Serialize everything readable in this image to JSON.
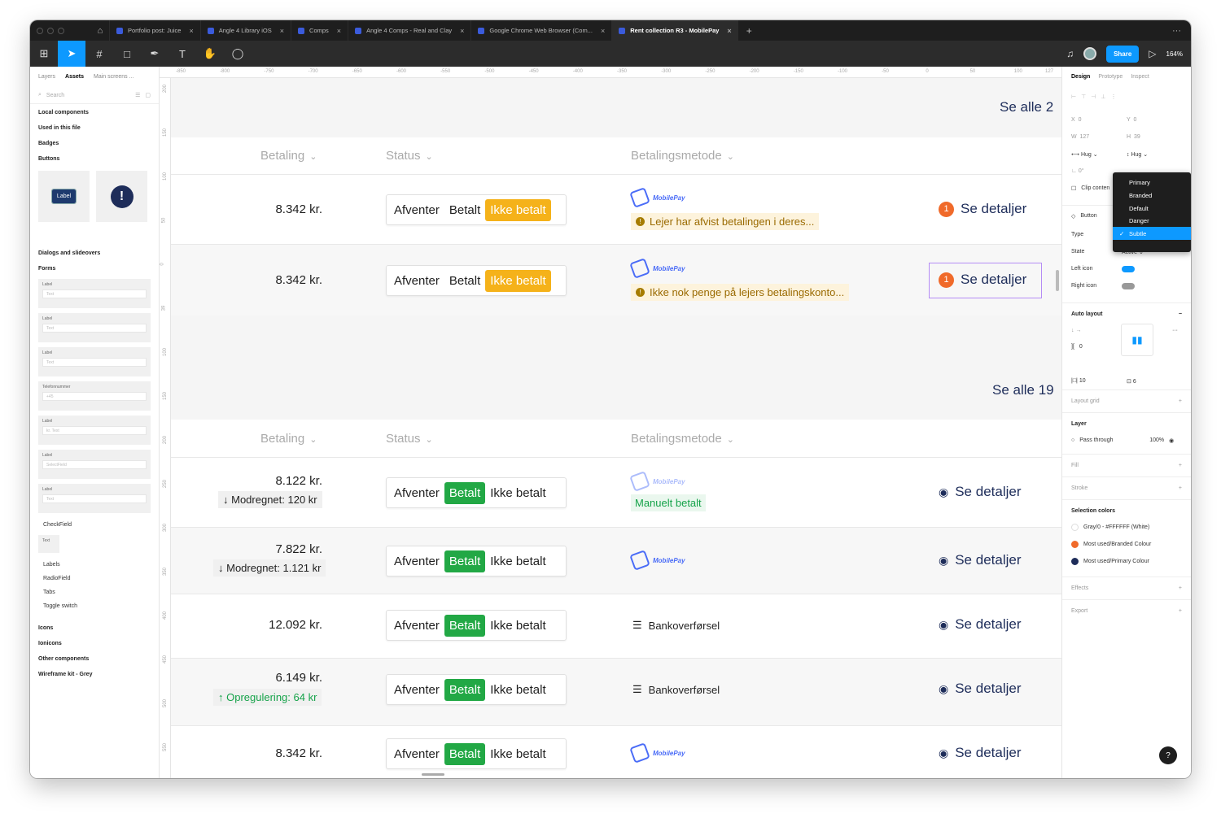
{
  "tabs": [
    {
      "label": "Portfolio post: Juice"
    },
    {
      "label": "Angle 4 Library iOS"
    },
    {
      "label": "Comps"
    },
    {
      "label": "Angle 4 Comps - Real and Clay"
    },
    {
      "label": "Google Chrome Web Browser (Com..."
    },
    {
      "label": "Rent collection R3 - MobilePay"
    }
  ],
  "toolbar": {
    "share": "Share",
    "zoom": "164%"
  },
  "left": {
    "tabs": [
      "Layers",
      "Assets",
      "Main screens ..."
    ],
    "search_placeholder": "Search",
    "sections": [
      "Local components",
      "Used in this file",
      "Badges",
      "Buttons",
      "Dialogs and slideovers",
      "Forms"
    ],
    "button_label": "Label",
    "form_thumbs": [
      {
        "label": "Label",
        "text": "Text"
      },
      {
        "label": "Label",
        "text": "Text"
      },
      {
        "label": "Label",
        "text": "Text"
      },
      {
        "label": "Telefonnummer",
        "text": "+45"
      },
      {
        "label": "Label",
        "text": "kr.  Text"
      },
      {
        "label": "Label",
        "text": "SelectField"
      },
      {
        "label": "Label",
        "text": "Text"
      }
    ],
    "checkfield": "CheckField",
    "checkfield_text": "Text",
    "subs": [
      "Labels",
      "RadioField",
      "Tabs",
      "Toggle switch"
    ],
    "bottom": [
      "Icons",
      "Ionicons",
      "Other components",
      "Wireframe kit - Grey"
    ]
  },
  "right": {
    "tabs": [
      "Design",
      "Prototype",
      "Inspect"
    ],
    "x": "0",
    "y": "0",
    "w": "127",
    "h": "39",
    "hug_w": "Hug",
    "hug_h": "Hug",
    "rotation": "0°",
    "clip": "Clip conten",
    "component": "Button",
    "type_label": "Type",
    "state_label": "State",
    "state_value": "Active",
    "left_icon": "Left icon",
    "right_icon": "Right icon",
    "auto_layout": "Auto layout",
    "spacing": "0",
    "padding_h": "10",
    "padding_v": "6",
    "layout_grid": "Layout grid",
    "layer": "Layer",
    "blend": "Pass through",
    "opacity": "100%",
    "fill": "Fill",
    "stroke": "Stroke",
    "selection_colors": "Selection colors",
    "colors": [
      {
        "name": "Gray/0 - #FFFFFF (White)",
        "hex": "#FFFFFF"
      },
      {
        "name": "Most used/Branded Colour",
        "hex": "#F06A2A"
      },
      {
        "name": "Most used/Primary Colour",
        "hex": "#1E2D5A"
      }
    ],
    "effects": "Effects",
    "export": "Export"
  },
  "dropdown": [
    "Primary",
    "Branded",
    "Default",
    "Danger",
    "Subtle"
  ],
  "ruler_top": [
    "-850",
    "-800",
    "-750",
    "-700",
    "-650",
    "-600",
    "-550",
    "-500",
    "-450",
    "-400",
    "-350",
    "-300",
    "-250",
    "-200",
    "-150",
    "-100",
    "-50",
    "0",
    "50",
    "100",
    "127"
  ],
  "ruler_left": [
    "200",
    "150",
    "100",
    "50",
    "0",
    "39",
    "100",
    "150",
    "200",
    "250",
    "300",
    "350",
    "400",
    "450",
    "500",
    "550"
  ],
  "canvas": {
    "see_all_1": "Se alle 2",
    "see_all_2": "Se alle 19",
    "headers": {
      "betaling": "Betaling",
      "status": "Status",
      "metode": "Betalingsmetode"
    },
    "seg": [
      "Afventer",
      "Betalt",
      "Ikke betalt"
    ],
    "details": "Se detaljer",
    "rows1": [
      {
        "amount": "8.342 kr.",
        "warn": "Lejer har afvist betalingen i deres...",
        "badge": "1"
      },
      {
        "amount": "8.342 kr.",
        "warn": "Ikke nok penge på lejers betalingskonto...",
        "badge": "1"
      }
    ],
    "rows2": [
      {
        "amount": "8.122 kr.",
        "adj": "Modregnet: 120 kr",
        "method": "MobilePay",
        "note": "Manuelt betalt"
      },
      {
        "amount": "7.822 kr.",
        "adj": "Modregnet: 1.121 kr",
        "method": "MobilePay"
      },
      {
        "amount": "12.092 kr.",
        "method": "Bankoverførsel"
      },
      {
        "amount": "6.149 kr.",
        "adj": "Opregulering: 64 kr",
        "method": "Bankoverførsel"
      },
      {
        "amount": "8.342 kr.",
        "method": "MobilePay"
      }
    ],
    "mobilepay": "MobilePay"
  },
  "help": "?"
}
